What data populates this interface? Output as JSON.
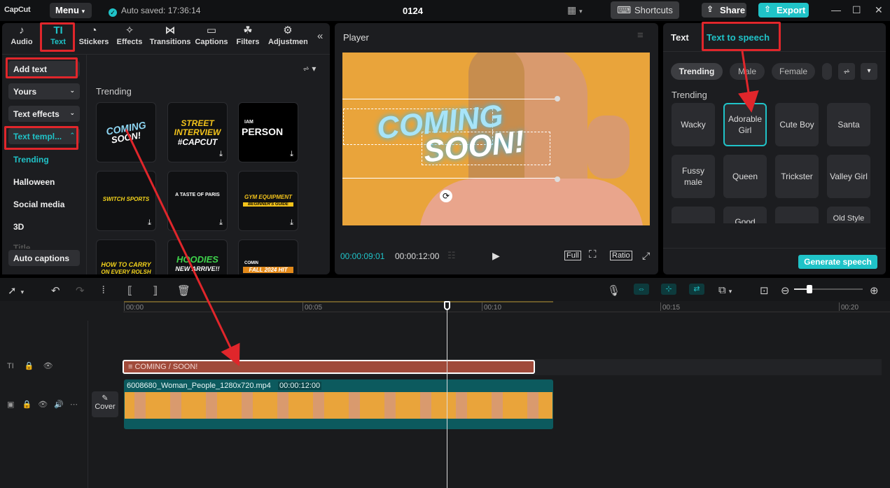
{
  "topbar": {
    "logo": "CapCut",
    "menu": "Menu",
    "autosave": "Auto saved: 17:36:14",
    "title": "0124",
    "shortcuts": "Shortcuts",
    "share": "Share",
    "export": "Export"
  },
  "tabs": [
    {
      "label": "Audio",
      "icon": "music-note-icon"
    },
    {
      "label": "Text",
      "icon": "text-tool-icon"
    },
    {
      "label": "Stickers",
      "icon": "sticker-icon"
    },
    {
      "label": "Effects",
      "icon": "sparkle-icon"
    },
    {
      "label": "Transitions",
      "icon": "transition-icon"
    },
    {
      "label": "Captions",
      "icon": "captions-icon"
    },
    {
      "label": "Filters",
      "icon": "filter-icon"
    },
    {
      "label": "Adjustmen",
      "icon": "adjust-icon"
    }
  ],
  "sidebar": {
    "add_text": "Add text",
    "yours": "Yours",
    "text_effects": "Text effects",
    "text_templates": "Text templ...",
    "links": [
      "Trending",
      "Halloween",
      "Social media",
      "3D",
      "Title"
    ],
    "auto_captions": "Auto captions"
  },
  "library": {
    "section": "Trending",
    "thumbs": [
      {
        "l1": "COMING",
        "l2": "SOON!"
      },
      {
        "l1": "STREET",
        "l2": "INTERVIEW",
        "l3": "#CAPCUT"
      },
      {
        "l1": "IAM",
        "l2": "PERSON"
      },
      {
        "l1": "SWITCH SPORTS"
      },
      {
        "l1": "A TASTE OF PARIS"
      },
      {
        "l1": "GYM EQUIPMENT",
        "l2": "BEGINNER'S GUIDE"
      },
      {
        "l1": "HOW TO CARRY",
        "l2": "ON EVERY ROLSH"
      },
      {
        "l1": "HOODIES",
        "l2": "NEW ARRIVE!!"
      },
      {
        "l1": "COMIN",
        "l2": "FALL 2024 HIT"
      }
    ]
  },
  "player": {
    "label": "Player",
    "overlay_line1": "COMING",
    "overlay_line2": "SOON!",
    "current_time": "00:00:09:01",
    "total_time": "00:00:12:00",
    "full": "Full",
    "ratio": "Ratio"
  },
  "right_panel": {
    "tab_text": "Text",
    "tab_tts": "Text to speech",
    "chips": [
      "Trending",
      "Male",
      "Female"
    ],
    "section": "Trending",
    "voices": [
      "Wacky",
      "Adorable Girl",
      "Cute Boy",
      "Santa",
      "Fussy male",
      "Queen",
      "Trickster",
      "Valley Girl",
      "",
      "Good",
      "",
      "Old Style"
    ],
    "generate": "Generate speech"
  },
  "timeline": {
    "ruler": [
      "00:00",
      "00:05",
      "00:10",
      "00:15",
      "00:20"
    ],
    "text_clip": "COMING / SOON!",
    "video_name": "6008680_Woman_People_1280x720.mp4",
    "video_duration": "00:00:12:00",
    "cover": "Cover"
  },
  "colors": {
    "accent": "#20c3c8",
    "annotation": "#e0262b",
    "text_clip": "#a04a3a",
    "video_clip": "#0c5a5e"
  }
}
